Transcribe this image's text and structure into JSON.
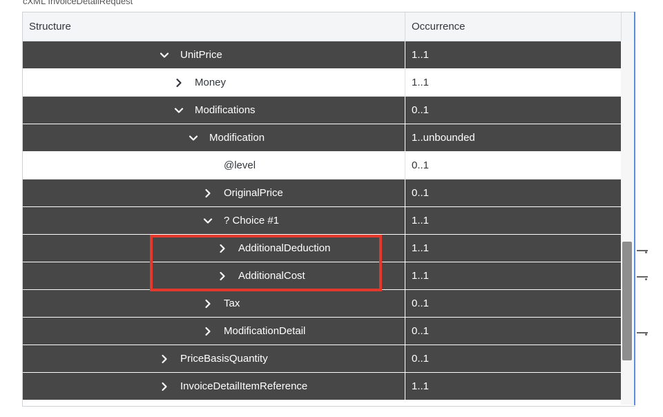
{
  "caption": "cXML InvoiceDetailRequest",
  "columns": {
    "structure": "Structure",
    "occurrence": "Occurrence"
  },
  "rows": [
    {
      "label": "UnitPrice",
      "occurrence": "1..1",
      "icon": "chevron-down-icon",
      "style": "dark"
    },
    {
      "label": "Money",
      "occurrence": "1..1",
      "icon": "chevron-right-icon",
      "style": "light"
    },
    {
      "label": "Modifications",
      "occurrence": "0..1",
      "icon": "chevron-down-icon",
      "style": "dark"
    },
    {
      "label": "Modification",
      "occurrence": "1..unbounded",
      "icon": "chevron-down-icon",
      "style": "dark"
    },
    {
      "label": "@level",
      "occurrence": "0..1",
      "icon": "none",
      "style": "light"
    },
    {
      "label": "OriginalPrice",
      "occurrence": "0..1",
      "icon": "chevron-right-icon",
      "style": "dark"
    },
    {
      "label": "? Choice #1",
      "occurrence": "1..1",
      "icon": "chevron-down-icon",
      "style": "dark"
    },
    {
      "label": "AdditionalDeduction",
      "occurrence": "1..1",
      "icon": "chevron-right-icon",
      "style": "dark"
    },
    {
      "label": "AdditionalCost",
      "occurrence": "1..1",
      "icon": "chevron-right-icon",
      "style": "dark"
    },
    {
      "label": "Tax",
      "occurrence": "0..1",
      "icon": "chevron-right-icon",
      "style": "dark"
    },
    {
      "label": "ModificationDetail",
      "occurrence": "0..1",
      "icon": "chevron-right-icon",
      "style": "dark"
    },
    {
      "label": "PriceBasisQuantity",
      "occurrence": "0..1",
      "icon": "chevron-right-icon",
      "style": "dark"
    },
    {
      "label": "InvoiceDetailItemReference",
      "occurrence": "1..1",
      "icon": "chevron-right-icon",
      "style": "dark"
    }
  ],
  "highlight_color": "#e2392c",
  "row_dark_color": "#474747"
}
